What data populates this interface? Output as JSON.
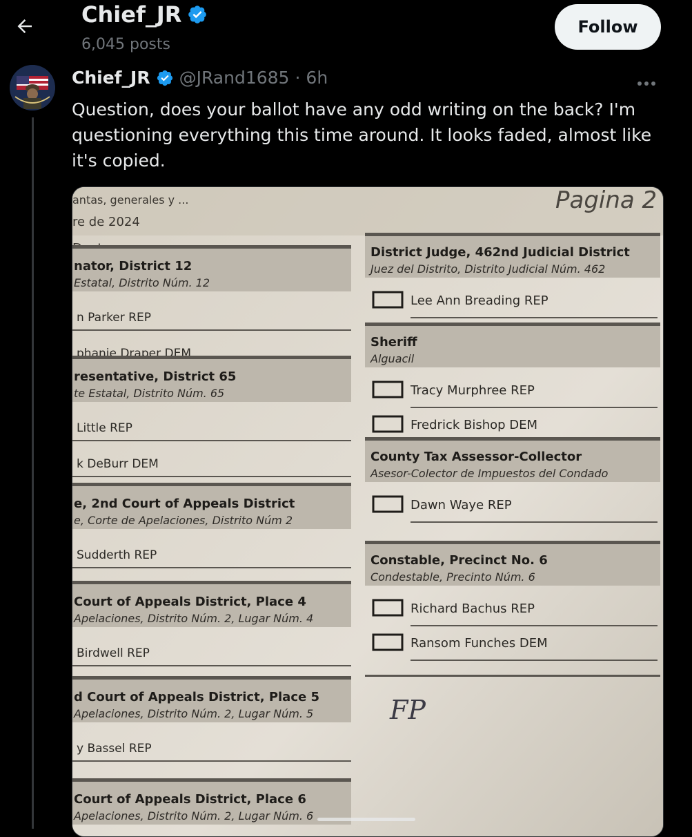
{
  "header": {
    "title": "Chief_JR",
    "posts_count": "6,045 posts",
    "follow_label": "Follow"
  },
  "post": {
    "name": "Chief_JR",
    "handle": "@JRand1685",
    "separator": "·",
    "time": "6h",
    "text": "Question, does your ballot have any odd writing on the back? I'm questioning everything this time around. It looks faded, almost like it's copied."
  },
  "ballot": {
    "top_lines": [
      "antas, generales y ...",
      "re de 2024",
      "Denton"
    ],
    "page_label": "Pagina 2",
    "left_sections": [
      {
        "title": "nator, District 12",
        "subtitle": "Estatal, Distrito Núm. 12",
        "candidates": [
          "n Parker REP",
          "phanie Draper DEM"
        ]
      },
      {
        "title": "resentative, District 65",
        "subtitle": "te Estatal, Distrito Núm. 65",
        "candidates": [
          "Little REP",
          "k DeBurr DEM"
        ]
      },
      {
        "title": "e, 2nd Court of Appeals District",
        "subtitle": "e, Corte de Apelaciones, Distrito Núm 2",
        "candidates": [
          "Sudderth REP"
        ]
      },
      {
        "title": "Court of Appeals District, Place 4",
        "subtitle": "Apelaciones, Distrito Núm. 2, Lugar Núm. 4",
        "candidates": [
          "Birdwell REP"
        ]
      },
      {
        "title": "d Court of Appeals District, Place 5",
        "subtitle": "Apelaciones, Distrito Núm. 2, Lugar Núm. 5",
        "candidates": [
          "y Bassel REP"
        ]
      },
      {
        "title": "Court of Appeals District, Place 6",
        "subtitle": "Apelaciones, Distrito Núm. 2, Lugar Núm. 6",
        "candidates": []
      }
    ],
    "right_sections": [
      {
        "title": "District Judge, 462nd Judicial District",
        "subtitle": "Juez del Distrito, Distrito Judicial Núm. 462",
        "candidates": [
          "Lee Ann Breading REP"
        ]
      },
      {
        "title": "Sheriff",
        "subtitle": "Alguacil",
        "candidates": [
          "Tracy Murphree REP",
          "Fredrick Bishop DEM"
        ]
      },
      {
        "title": "County Tax Assessor-Collector",
        "subtitle": "Asesor-Colector de Impuestos del Condado",
        "candidates": [
          "Dawn Waye REP"
        ]
      },
      {
        "title": "Constable, Precinct No. 6",
        "subtitle": "Condestable, Precinto Núm. 6",
        "candidates": [
          "Richard Bachus REP",
          "Ransom Funches  DEM"
        ]
      }
    ],
    "initials": "FP"
  },
  "icons": {
    "back": "arrow-left-icon",
    "verified": "verified-badge-icon",
    "more": "more-horizontal-icon"
  },
  "colors": {
    "background": "#000000",
    "verified": "#1d9bf0",
    "follow_bg": "#eff3f4"
  }
}
